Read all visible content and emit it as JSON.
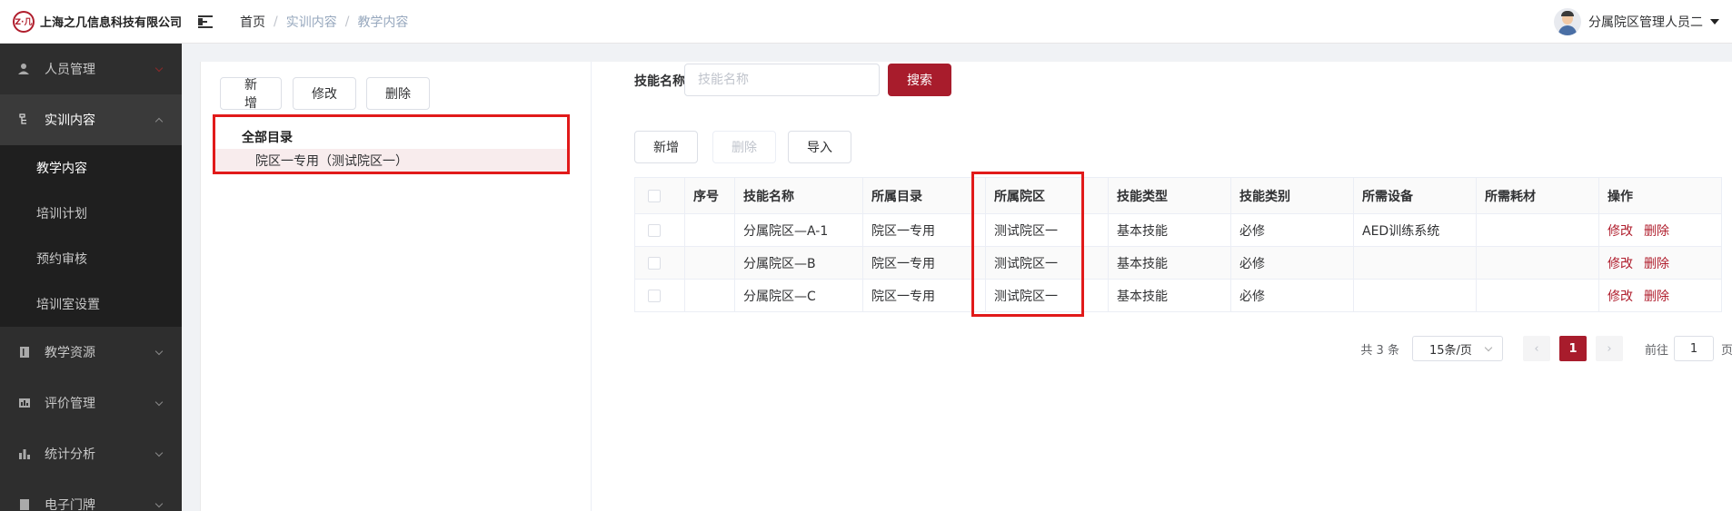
{
  "header": {
    "logo_mark": "Z·几",
    "company": "上海之几信息科技有限公司",
    "breadcrumb": [
      "首页",
      "实训内容",
      "教学内容"
    ],
    "user_name": "分属院区管理人员二"
  },
  "sidebar": {
    "items": [
      {
        "label": "人员管理",
        "icon": "user-icon"
      },
      {
        "label": "实训内容",
        "icon": "tree-icon",
        "open": true,
        "children": [
          {
            "label": "教学内容",
            "active": true
          },
          {
            "label": "培训计划"
          },
          {
            "label": "预约审核"
          },
          {
            "label": "培训室设置"
          }
        ]
      },
      {
        "label": "教学资源",
        "icon": "book-icon"
      },
      {
        "label": "评价管理",
        "icon": "chart-icon"
      },
      {
        "label": "统计分析",
        "icon": "bar-chart-icon"
      },
      {
        "label": "电子门牌",
        "icon": "door-icon"
      }
    ]
  },
  "left_panel": {
    "buttons": {
      "add": "新增",
      "edit": "修改",
      "delete": "删除"
    },
    "tree": {
      "root": "全部目录",
      "node": "院区一专用（测试院区一）"
    }
  },
  "right_panel": {
    "search_label": "技能名称",
    "search_placeholder": "技能名称",
    "search_button": "搜索",
    "buttons": {
      "add": "新增",
      "delete": "删除",
      "import": "导入"
    },
    "table": {
      "headers": [
        "",
        "序号",
        "技能名称",
        "所属目录",
        "所属院区",
        "技能类型",
        "技能类别",
        "所需设备",
        "所需耗材",
        "操作"
      ],
      "rows": [
        {
          "name": "分属院区—A-1",
          "catalog": "院区一专用",
          "campus": "测试院区一",
          "type": "基本技能",
          "category": "必修",
          "device": "AED训练系统",
          "consumable": ""
        },
        {
          "name": "分属院区—B",
          "catalog": "院区一专用",
          "campus": "测试院区一",
          "type": "基本技能",
          "category": "必修",
          "device": "",
          "consumable": ""
        },
        {
          "name": "分属院区—C",
          "catalog": "院区一专用",
          "campus": "测试院区一",
          "type": "基本技能",
          "category": "必修",
          "device": "",
          "consumable": ""
        }
      ],
      "op_edit": "修改",
      "op_delete": "删除"
    },
    "pagination": {
      "total": "共 3 条",
      "page_size": "15条/页",
      "prev": "‹",
      "current": "1",
      "next": "›",
      "goto_label": "前往",
      "goto_value": "1",
      "goto_suffix": "页"
    }
  },
  "colors": {
    "accent": "#a81c2c",
    "sidebar_bg": "#2e2e2e",
    "highlight_box": "#e11a1a"
  }
}
